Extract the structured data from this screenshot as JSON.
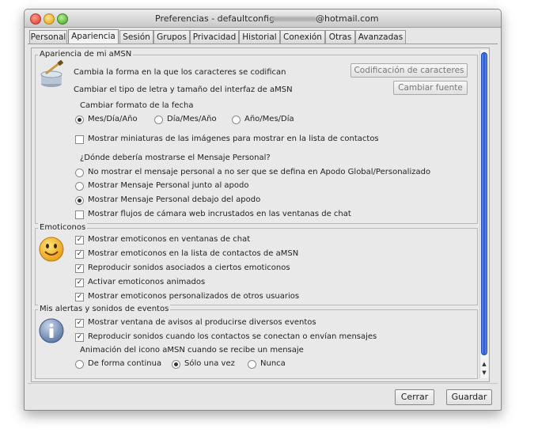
{
  "window": {
    "title_left": "Preferencias - defaultconfig -",
    "title_right": "@hotmail.com"
  },
  "tabs": [
    {
      "label": "Personal"
    },
    {
      "label": "Apariencia"
    },
    {
      "label": "Sesión"
    },
    {
      "label": "Grupos"
    },
    {
      "label": "Privacidad"
    },
    {
      "label": "Historial"
    },
    {
      "label": "Conexión"
    },
    {
      "label": "Otras"
    },
    {
      "label": "Avanzadas"
    }
  ],
  "apariencia": {
    "legend": "Apariencia de mi aMSN",
    "encoding_text": "Cambia la forma en la que los caracteres se codifican",
    "encoding_button": "Codificación de caracteres",
    "font_text": "Cambiar el tipo de letra y tamaño del interfaz de aMSN",
    "font_button": "Cambiar fuente",
    "date_label": "Cambiar formato de la fecha",
    "date_options": [
      "Mes/Día/Año",
      "Día/Mes/Año",
      "Año/Mes/Día"
    ],
    "date_selected": "Mes/Día/Año",
    "thumbnails": "Mostrar miniaturas de las imágenes para mostrar en la lista de contactos",
    "thumbnails_checked": false,
    "psm_question": "¿Dónde debería mostrarse el Mensaje Personal?",
    "psm_options": [
      "No mostrar el mensaje personal a no ser que se defina en Apodo Global/Personalizado",
      "Mostrar Mensaje Personal junto al apodo",
      "Mostrar Mensaje Personal debajo del apodo"
    ],
    "psm_selected": "Mostrar Mensaje Personal debajo del apodo",
    "webcam": "Mostrar flujos de cámara web incrustados en las ventanas de chat",
    "webcam_checked": false
  },
  "emoticonos": {
    "legend": "Emoticonos",
    "options": [
      {
        "label": "Mostrar emoticonos en ventanas de chat",
        "checked": true
      },
      {
        "label": "Mostrar emoticonos en la lista de contactos de aMSN",
        "checked": true
      },
      {
        "label": "Reproducir sonidos asociados a ciertos emoticonos",
        "checked": true
      },
      {
        "label": "Activar emoticonos animados",
        "checked": true
      },
      {
        "label": "Mostrar emoticonos personalizados de otros usuarios",
        "checked": true
      }
    ]
  },
  "alertas": {
    "legend": "Mis alertas y sonidos de eventos",
    "options": [
      {
        "label": "Mostrar ventana de avisos al producirse diversos eventos",
        "checked": true
      },
      {
        "label": "Reproducir sonidos cuando los contactos se conectan o envían mensajes",
        "checked": true
      }
    ],
    "anim_label": "Animación del icono aMSN cuando se recibe un mensaje",
    "anim_options": [
      "De forma continua",
      "Sólo una vez",
      "Nunca"
    ],
    "anim_selected": "Sólo una vez"
  },
  "buttons": {
    "cancel": "Cerrar",
    "save": "Guardar"
  },
  "icons": [
    "paint-bucket-icon",
    "smiley-icon",
    "info-icon"
  ],
  "colors": {
    "scroll_accent": "#2358d8",
    "window_bg": "#e6e6e6"
  }
}
